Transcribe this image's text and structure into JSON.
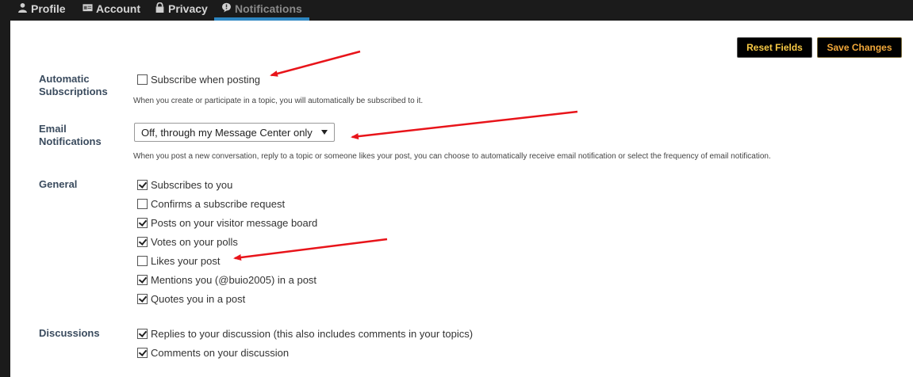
{
  "tabs": [
    {
      "label": "Profile",
      "icon": "profile-icon"
    },
    {
      "label": "Account",
      "icon": "account-card-icon"
    },
    {
      "label": "Privacy",
      "icon": "lock-icon"
    },
    {
      "label": "Notifications",
      "icon": "alert-bubble-icon",
      "active": true
    }
  ],
  "actions": {
    "reset_label": "Reset Fields",
    "save_label": "Save Changes"
  },
  "sections": {
    "auto": {
      "label_line1": "Automatic",
      "label_line2": "Subscriptions",
      "option": {
        "label": "Subscribe when posting",
        "checked": false
      },
      "help": "When you create or participate in a topic, you will automatically be subscribed to it."
    },
    "email": {
      "label_line1": "Email",
      "label_line2": "Notifications",
      "selected": "Off, through my Message Center only",
      "help": "When you post a new conversation, reply to a topic or someone likes your post, you can choose to automatically receive email notification or select the frequency of email notification."
    },
    "general": {
      "label": "General",
      "options": [
        {
          "label": "Subscribes to you",
          "checked": true
        },
        {
          "label": "Confirms a subscribe request",
          "checked": false
        },
        {
          "label": "Posts on your visitor message board",
          "checked": true
        },
        {
          "label": "Votes on your polls",
          "checked": true
        },
        {
          "label": "Likes your post",
          "checked": false
        },
        {
          "label": "Mentions you (@buio2005) in a post",
          "checked": true
        },
        {
          "label": "Quotes you in a post",
          "checked": true
        }
      ]
    },
    "discussions": {
      "label": "Discussions",
      "options": [
        {
          "label": "Replies to your discussion (this also includes comments in your topics)",
          "checked": true
        },
        {
          "label": "Comments on your discussion",
          "checked": true
        }
      ]
    }
  },
  "colors": {
    "arrow": "#e8141a",
    "tab_active_underline": "#2e86c1",
    "section_label": "#3a4b5e"
  }
}
